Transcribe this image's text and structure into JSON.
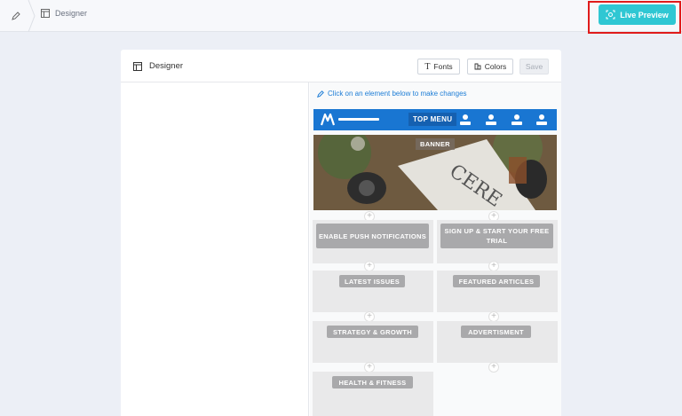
{
  "topbar": {
    "breadcrumb": "Designer",
    "live_preview": "Live Preview"
  },
  "panel": {
    "title": "Designer",
    "fonts": "Fonts",
    "colors": "Colors",
    "save": "Save"
  },
  "canvas": {
    "hint": "Click on an element below to make changes",
    "top_menu": "TOP MENU",
    "banner": "BANNER",
    "blocks": {
      "push": "ENABLE PUSH NOTIFICATIONS",
      "signup": "SIGN UP & START YOUR FREE TRIAL",
      "latest": "LATEST ISSUES",
      "featured": "FEATURED ARTICLES",
      "strategy": "STRATEGY & GROWTH",
      "advert": "ADVERTISMENT",
      "health": "HEALTH & FITNESS"
    }
  },
  "colors": {
    "accent": "#2fc7d3",
    "top_menu": "#1976d2",
    "highlight": "#e01b1b",
    "link": "#1d7dd6"
  }
}
